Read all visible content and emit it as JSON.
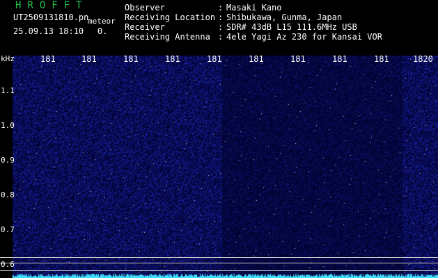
{
  "app": {
    "title": "HROFFT",
    "file_name": "UT2509131810.pn",
    "meteor_label": "meteor",
    "datetime": "25.09.13 18:10",
    "datetime_extra": "0."
  },
  "info": [
    {
      "key": "Observer",
      "sep": ":",
      "value": "Masaki Kano"
    },
    {
      "key": "Receiving Location",
      "sep": ":",
      "value": "Shibukawa, Gunma, Japan"
    },
    {
      "key": "Receiver",
      "sep": ":",
      "value": "SDR# 43dB L15 111.6MHz USB"
    },
    {
      "key": "Receiving Antenna",
      "sep": ":",
      "value": "4ele Yagi Az 230 for Kansai VOR"
    }
  ],
  "axis": {
    "unit": "kHz",
    "x_ticks": [
      "181",
      "181",
      "181",
      "181",
      "181",
      "181",
      "181",
      "181",
      "181",
      "1820"
    ],
    "y_ticks": [
      "1.1",
      "1.0",
      "0.9",
      "0.8",
      "0.7",
      "0.6"
    ]
  },
  "colors": {
    "background": "#000000",
    "title_green": "#22c34a",
    "noise_blue": "#2030a0",
    "baseline_cyan": "#40e0ff",
    "ref_line": "#c8c8c8"
  }
}
